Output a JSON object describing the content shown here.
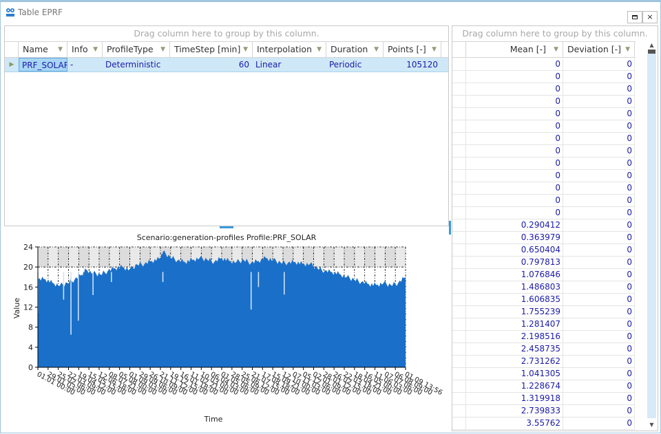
{
  "window": {
    "title": "Table EPRF",
    "icon": "eprf-logo-icon",
    "buttons": {
      "maximize": "maximize-icon",
      "close": "×"
    }
  },
  "left_grid": {
    "group_hint": "Drag column here to group by this column.",
    "columns": [
      "Name",
      "Info",
      "ProfileType",
      "TimeStep [min]",
      "Interpolation",
      "Duration",
      "Points [-]"
    ],
    "rows": [
      {
        "Name": "PRF_SOLAR",
        "Info": "-",
        "ProfileType": "Deterministic",
        "TimeStep": "60",
        "Interpolation": "Linear",
        "Duration": "Periodic",
        "Points": "105120"
      }
    ]
  },
  "right_grid": {
    "group_hint": "Drag column here to group by this column.",
    "columns": [
      "Mean [-]",
      "Deviation [-]"
    ],
    "rows": [
      [
        "0",
        "0"
      ],
      [
        "0",
        "0"
      ],
      [
        "0",
        "0"
      ],
      [
        "0",
        "0"
      ],
      [
        "0",
        "0"
      ],
      [
        "0",
        "0"
      ],
      [
        "0",
        "0"
      ],
      [
        "0",
        "0"
      ],
      [
        "0",
        "0"
      ],
      [
        "0",
        "0"
      ],
      [
        "0",
        "0"
      ],
      [
        "0",
        "0"
      ],
      [
        "0",
        "0"
      ],
      [
        "0.290412",
        "0"
      ],
      [
        "0.363979",
        "0"
      ],
      [
        "0.650404",
        "0"
      ],
      [
        "0.797813",
        "0"
      ],
      [
        "1.076846",
        "0"
      ],
      [
        "1.486803",
        "0"
      ],
      [
        "1.606835",
        "0"
      ],
      [
        "1.755239",
        "0"
      ],
      [
        "1.281407",
        "0"
      ],
      [
        "2.198516",
        "0"
      ],
      [
        "2.458735",
        "0"
      ],
      [
        "2.731262",
        "0"
      ],
      [
        "1.041305",
        "0"
      ],
      [
        "1.228674",
        "0"
      ],
      [
        "1.319918",
        "0"
      ],
      [
        "2.739833",
        "0"
      ],
      [
        "3.55762",
        "0"
      ]
    ]
  },
  "chart_data": {
    "type": "area",
    "title": "Scenario:generation-profiles Profile:PRF_SOLAR",
    "xlabel": "Time",
    "ylabel": "Value",
    "ylim": [
      0,
      24
    ],
    "yticks": [
      0,
      4,
      8,
      12,
      16,
      20,
      24
    ],
    "grid": true,
    "color": "#1a6fc9",
    "xtick_labels": [
      "01.01 00:00",
      "29.01 03:00",
      "25.02 06:00",
      "22.03 09:00",
      "19.04 12:00",
      "15.05 15:00",
      "12.06 18:00",
      "08.07 21:00",
      "05.08 00:00",
      "01.09 03:00",
      "29.09 06:00",
      "26.10 09:00",
      "21.11 12:00",
      "19.12 15:00",
      "16.01 18:00",
      "11.02 21:00",
      "10.03 00:00",
      "06.04 03:00",
      "01.05 06:00",
      "28.05 09:00",
      "25.06 12:00",
      "21.07 15:00",
      "17.08 18:00",
      "15.09 21:00",
      "12.10 00:00",
      "07.11 03:00",
      "05.12 06:00",
      "02.01 09:00",
      "28.01 12:00",
      "26.02 15:00",
      "22.03 18:00",
      "18.04 21:00",
      "16.05 00:00",
      "11.06 03:00",
      "07.07 06:00",
      "06.08 09:00",
      "01.09 13:56"
    ],
    "envelope_points": [
      [
        0,
        17.5
      ],
      [
        0.02,
        17.6
      ],
      [
        0.04,
        16.8
      ],
      [
        0.06,
        16.3
      ],
      [
        0.08,
        16.8
      ],
      [
        0.1,
        17.5
      ],
      [
        0.12,
        18.5
      ],
      [
        0.13,
        19.5
      ],
      [
        0.15,
        18.8
      ],
      [
        0.17,
        18.5
      ],
      [
        0.19,
        19.2
      ],
      [
        0.21,
        19.8
      ],
      [
        0.23,
        20.0
      ],
      [
        0.25,
        19.5
      ],
      [
        0.27,
        20.5
      ],
      [
        0.29,
        20.6
      ],
      [
        0.31,
        21.2
      ],
      [
        0.33,
        21.6
      ],
      [
        0.34,
        23.0
      ],
      [
        0.36,
        22.0
      ],
      [
        0.38,
        21.3
      ],
      [
        0.4,
        21.0
      ],
      [
        0.42,
        21.4
      ],
      [
        0.44,
        21.8
      ],
      [
        0.46,
        21.5
      ],
      [
        0.48,
        21.0
      ],
      [
        0.5,
        21.8
      ],
      [
        0.52,
        21.2
      ],
      [
        0.54,
        21.0
      ],
      [
        0.56,
        21.4
      ],
      [
        0.58,
        20.8
      ],
      [
        0.6,
        21.2
      ],
      [
        0.62,
        21.8
      ],
      [
        0.64,
        21.4
      ],
      [
        0.66,
        20.9
      ],
      [
        0.68,
        20.8
      ],
      [
        0.7,
        21.0
      ],
      [
        0.72,
        20.6
      ],
      [
        0.74,
        20.6
      ],
      [
        0.76,
        19.8
      ],
      [
        0.78,
        19.2
      ],
      [
        0.8,
        19.0
      ],
      [
        0.82,
        18.6
      ],
      [
        0.84,
        18.0
      ],
      [
        0.86,
        17.5
      ],
      [
        0.88,
        17.0
      ],
      [
        0.9,
        16.6
      ],
      [
        0.92,
        16.4
      ],
      [
        0.94,
        16.8
      ],
      [
        0.96,
        16.4
      ],
      [
        0.98,
        16.8
      ],
      [
        1.0,
        18.0
      ]
    ],
    "dips": [
      [
        0.0,
        10.8
      ],
      [
        0.07,
        13.5
      ],
      [
        0.09,
        6.5
      ],
      [
        0.11,
        9.3
      ],
      [
        0.15,
        14.4
      ],
      [
        0.2,
        17.0
      ],
      [
        0.34,
        17.0
      ],
      [
        0.58,
        11.5
      ],
      [
        0.6,
        16.0
      ],
      [
        0.67,
        14.5
      ]
    ]
  }
}
